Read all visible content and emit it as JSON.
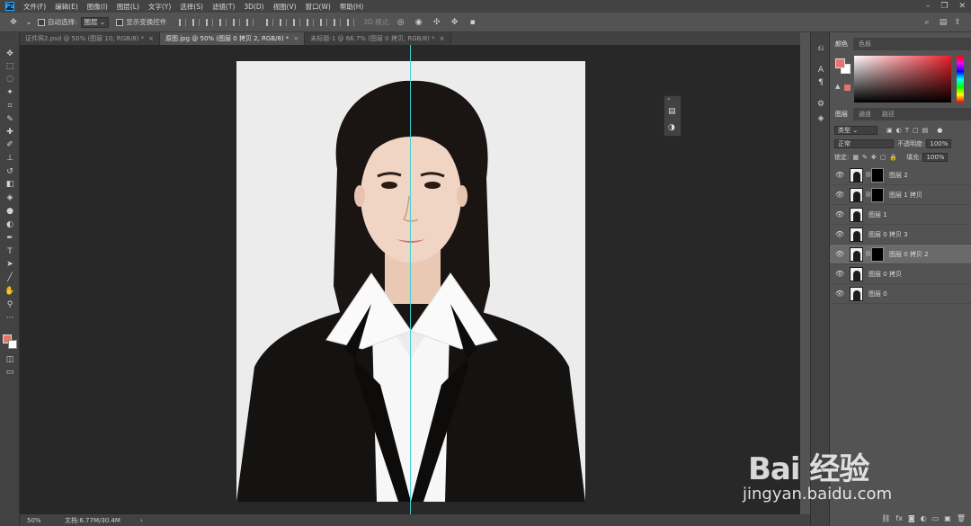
{
  "app": {
    "icon_text": "Ps"
  },
  "menu": [
    "文件(F)",
    "编辑(E)",
    "图像(I)",
    "图层(L)",
    "文字(Y)",
    "选择(S)",
    "滤镜(T)",
    "3D(D)",
    "视图(V)",
    "窗口(W)",
    "帮助(H)"
  ],
  "options": {
    "auto_select_label": "自动选择:",
    "auto_select_value": "图层",
    "show_transform_label": "显示变换控件",
    "mode_3d_label": "3D 模式:"
  },
  "tabs": [
    {
      "label": "证件照2.psd @ 50% (图层 10, RGB/8) *",
      "active": false
    },
    {
      "label": "原图.jpg @ 50% (图层 0 拷贝 2, RGB/8) *",
      "active": true
    },
    {
      "label": "未标题-1 @ 66.7% (图层 0 拷贝, RGB/8) *",
      "active": false
    }
  ],
  "status": {
    "zoom": "50%",
    "doc_info": "文档:6.77M/30.4M",
    "arrow": "›"
  },
  "color_panel": {
    "tabs": [
      "颜色",
      "色板"
    ],
    "fg_color": "#e8736a",
    "bg_color": "#ffffff"
  },
  "layers_panel": {
    "tabs": [
      "图层",
      "通道",
      "路径"
    ],
    "filter_label": "类型",
    "blend_mode": "正常",
    "opacity_label": "不透明度:",
    "opacity_value": "100%",
    "lock_label": "锁定:",
    "fill_label": "填充:",
    "fill_value": "100%",
    "layers": [
      {
        "name": "图层 2",
        "has_mask": true,
        "selected": false
      },
      {
        "name": "图层 1 拷贝",
        "has_mask": true,
        "selected": false
      },
      {
        "name": "图层 1",
        "has_mask": false,
        "selected": false
      },
      {
        "name": "图层 0 拷贝 3",
        "has_mask": false,
        "selected": false
      },
      {
        "name": "图层 0 拷贝 2",
        "has_mask": true,
        "selected": true
      },
      {
        "name": "图层 0 拷贝",
        "has_mask": false,
        "selected": false
      },
      {
        "name": "图层 0",
        "has_mask": false,
        "selected": false
      }
    ]
  },
  "watermark": {
    "logo": "Bai 经验",
    "url": "jingyan.baidu.com"
  },
  "colors": {
    "guide": "#3fd1d6",
    "canvas_bg": "#282828",
    "ui_bg": "#535353"
  }
}
